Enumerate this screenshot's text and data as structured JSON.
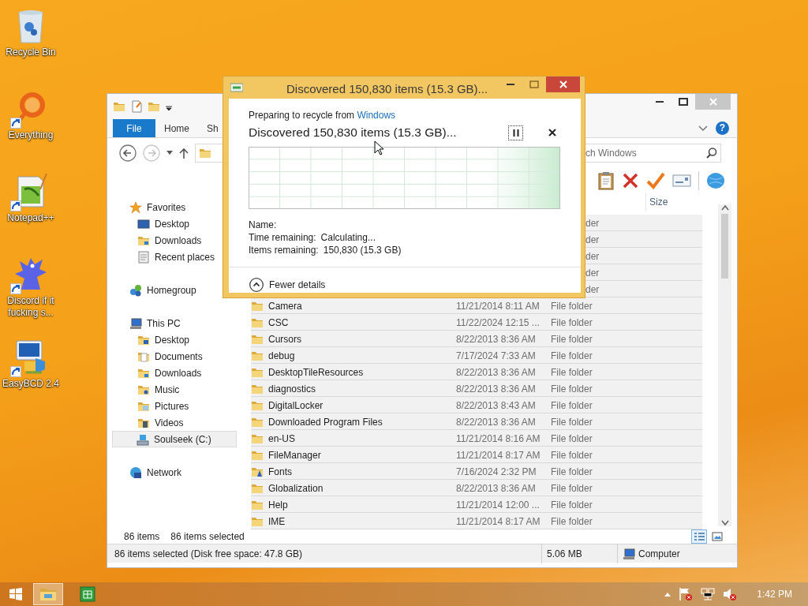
{
  "desktop_icons": [
    {
      "label": "Recycle Bin",
      "shortcut": false
    },
    {
      "label": "Everything",
      "shortcut": true
    },
    {
      "label": "Notepad++",
      "shortcut": true
    },
    {
      "label": "Discord if it fucking s...",
      "shortcut": true
    },
    {
      "label": "EasyBCD 2.4",
      "shortcut": true
    }
  ],
  "explorer": {
    "ribbon_tabs": [
      {
        "label": "File",
        "kind": "file"
      },
      {
        "label": "Home",
        "kind": "tab"
      },
      {
        "label": "Sh",
        "kind": "tab"
      }
    ],
    "help": "?",
    "search": {
      "placeholder": "ch Windows"
    },
    "size_column": "Size",
    "navigation": [
      {
        "label": "Favorites",
        "selected": false,
        "children": [
          {
            "label": "Desktop",
            "selected": false
          },
          {
            "label": "Downloads",
            "selected": false
          },
          {
            "label": "Recent places",
            "selected": false
          }
        ]
      },
      {
        "label": "Homegroup",
        "selected": false
      },
      {
        "label": "This PC",
        "selected": false,
        "children": [
          {
            "label": "Desktop",
            "selected": false
          },
          {
            "label": "Documents",
            "selected": false
          },
          {
            "label": "Downloads",
            "selected": false
          },
          {
            "label": "Music",
            "selected": false
          },
          {
            "label": "Pictures",
            "selected": false
          },
          {
            "label": "Videos",
            "selected": false
          },
          {
            "label": "Soulseek (C:)",
            "selected": true
          }
        ]
      },
      {
        "label": "Network",
        "selected": false
      }
    ],
    "covered_rows": [
      {
        "type": "der",
        "selected": true
      },
      {
        "type": "der",
        "selected": true
      },
      {
        "type": "der",
        "selected": true
      },
      {
        "type": "der",
        "selected": true
      },
      {
        "type": "der",
        "selected": true
      }
    ],
    "rows": [
      {
        "name": "Camera",
        "date": "11/21/2014 8:11 AM",
        "type": "File folder",
        "kind": "folder",
        "selected": true
      },
      {
        "name": "CSC",
        "date": "11/22/2024 12:15 ...",
        "type": "File folder",
        "kind": "folder",
        "selected": true
      },
      {
        "name": "Cursors",
        "date": "8/22/2013 8:36 AM",
        "type": "File folder",
        "kind": "folder",
        "selected": true
      },
      {
        "name": "debug",
        "date": "7/17/2024 7:33 AM",
        "type": "File folder",
        "kind": "folder",
        "selected": true
      },
      {
        "name": "DesktopTileResources",
        "date": "8/22/2013 8:36 AM",
        "type": "File folder",
        "kind": "folder",
        "selected": true
      },
      {
        "name": "diagnostics",
        "date": "8/22/2013 8:36 AM",
        "type": "File folder",
        "kind": "folder",
        "selected": true
      },
      {
        "name": "DigitalLocker",
        "date": "8/22/2013 8:43 AM",
        "type": "File folder",
        "kind": "folder",
        "selected": true
      },
      {
        "name": "Downloaded Program Files",
        "date": "8/22/2013 8:36 AM",
        "type": "File folder",
        "kind": "folder",
        "selected": true
      },
      {
        "name": "en-US",
        "date": "11/21/2014 8:16 AM",
        "type": "File folder",
        "kind": "folder",
        "selected": true
      },
      {
        "name": "FileManager",
        "date": "11/21/2014 8:17 AM",
        "type": "File folder",
        "kind": "folder",
        "selected": true
      },
      {
        "name": "Fonts",
        "date": "7/16/2024 2:32 PM",
        "type": "File folder",
        "kind": "fonts",
        "selected": true
      },
      {
        "name": "Globalization",
        "date": "8/22/2013 8:36 AM",
        "type": "File folder",
        "kind": "folder",
        "selected": true
      },
      {
        "name": "Help",
        "date": "11/21/2014 12:00 ...",
        "type": "File folder",
        "kind": "folder",
        "selected": true
      },
      {
        "name": "IME",
        "date": "11/21/2014 8:17 AM",
        "type": "File folder",
        "kind": "folder",
        "selected": true
      }
    ],
    "footer": {
      "count": "86 items",
      "selection": "86 items selected"
    },
    "views": [
      {
        "kind": "details",
        "selected": true
      },
      {
        "kind": "tiles",
        "selected": false
      }
    ],
    "status_bar": {
      "summary": "86 items selected (Disk free space: 47.8 GB)",
      "size": "5.06 MB",
      "location": "Computer"
    }
  },
  "dialog": {
    "title": "Discovered 150,830 items (15.3 GB)...",
    "intro": "Preparing to recycle from ",
    "source": "Windows",
    "heading": "Discovered 150,830 items (15.3 GB)...",
    "details": [
      {
        "label": "Name:"
      },
      {
        "label": "Time remaining:",
        "value": "Calculating..."
      },
      {
        "label": "Items remaining:",
        "value": "150,830 (15.3 GB)"
      }
    ],
    "toggle": "Fewer details"
  },
  "taskbar": {
    "apps": [
      {
        "selected": true
      },
      {
        "selected": false
      }
    ],
    "clock": "1:42 PM"
  }
}
